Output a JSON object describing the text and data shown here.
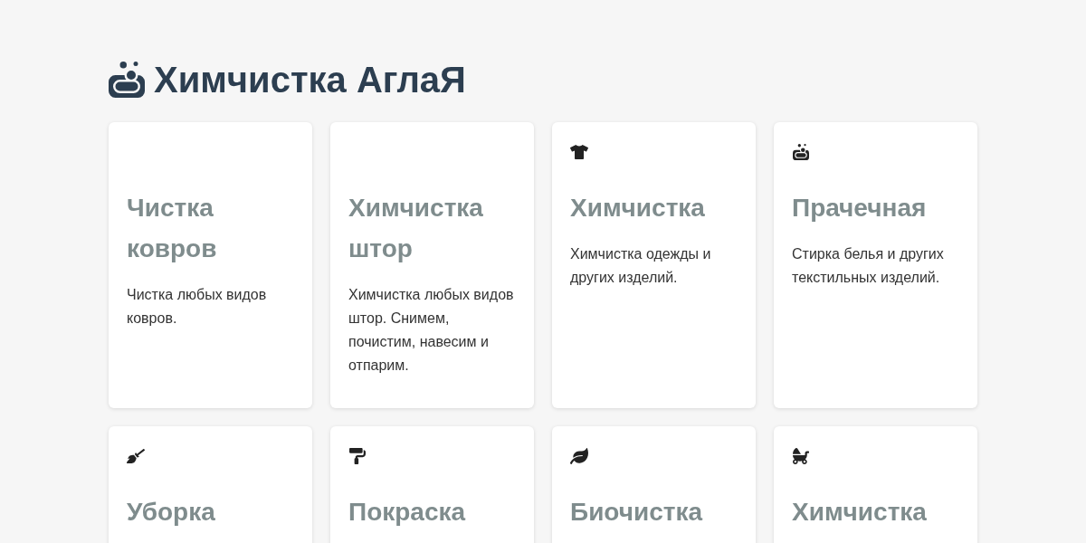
{
  "header": {
    "title": "Химчистка АглаЯ"
  },
  "services": [
    {
      "kind": "none",
      "title": "Чистка ковров",
      "description": "Чистка любых видов ковров."
    },
    {
      "kind": "none",
      "title": "Химчистка штор",
      "description": "Химчистка любых видов штор. Снимем, почистим, навесим и отпарим."
    },
    {
      "kind": "shirt",
      "title": "Химчистка",
      "description": "Химчистка одежды и других изделий."
    },
    {
      "kind": "soap",
      "title": "Прачечная",
      "description": "Стирка белья и других текстильных изделий."
    },
    {
      "kind": "broom",
      "title": "Уборка"
    },
    {
      "kind": "roller",
      "title": "Покраска"
    },
    {
      "kind": "leaf",
      "title": "Биочистка"
    },
    {
      "kind": "stroller",
      "title": "Химчистка"
    }
  ]
}
